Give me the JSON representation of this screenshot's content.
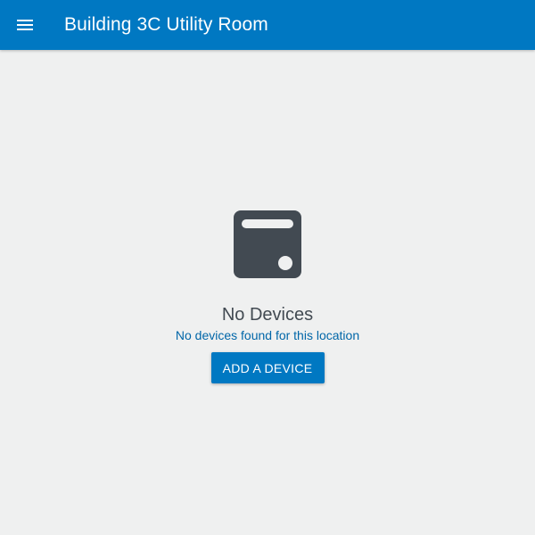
{
  "header": {
    "title": "Building 3C Utility Room",
    "menu_icon": "menu-icon",
    "background_color": "#0078c2"
  },
  "empty_state": {
    "icon": "device-icon",
    "title": "No Devices",
    "subtitle": "No devices found for this location",
    "action_label": "ADD A DEVICE"
  },
  "colors": {
    "accent": "#0078c2",
    "page_background": "#eff0f0",
    "icon": "#424a52"
  }
}
